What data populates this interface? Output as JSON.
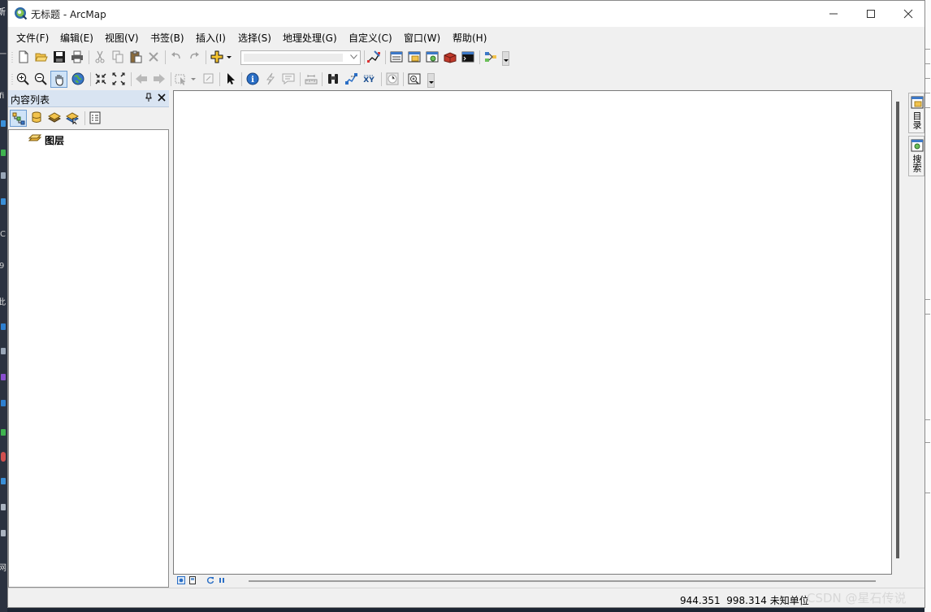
{
  "window": {
    "title": "无标题 - ArcMap"
  },
  "menu": [
    "文件(F)",
    "编辑(E)",
    "视图(V)",
    "书签(B)",
    "插入(I)",
    "选择(S)",
    "地理处理(G)",
    "自定义(C)",
    "窗口(W)",
    "帮助(H)"
  ],
  "toolbar_standard": {
    "buttons": [
      "new-icon",
      "open-icon",
      "save-icon",
      "print-icon",
      "cut-icon",
      "copy-icon",
      "paste-icon",
      "delete-icon",
      "undo-icon",
      "redo-icon",
      "add-data-icon",
      "editor-toolbar-icon",
      "table-of-contents-icon",
      "catalog-window-icon",
      "search-window-icon",
      "arctoolbox-icon",
      "python-icon",
      "model-builder-icon"
    ],
    "scale_value": ""
  },
  "toolbar_tools": {
    "buttons": [
      "zoom-in-icon",
      "zoom-out-icon",
      "pan-icon",
      "full-extent-icon",
      "fixed-zoom-in-icon",
      "fixed-zoom-out-icon",
      "back-icon",
      "forward-icon",
      "select-features-icon",
      "clear-selection-icon",
      "select-elements-icon",
      "identify-icon",
      "hyperlink-icon",
      "html-popup-icon",
      "measure-icon",
      "find-icon",
      "find-route-icon",
      "go-to-xy-icon",
      "time-slider-icon",
      "create-viewer-icon"
    ]
  },
  "toc": {
    "title": "内容列表",
    "tools": [
      "list-by-drawing-order-icon",
      "list-by-source-icon",
      "list-by-visibility-icon",
      "list-by-selection-icon",
      "options-icon"
    ],
    "tree": {
      "root_label": "图层"
    }
  },
  "dock": {
    "catalog_label": "目录",
    "search_label": "搜索"
  },
  "status": {
    "x": "944.351",
    "y": "998.314",
    "units": "未知单位"
  },
  "watermark": "CSDN @星石传说",
  "desktop": {
    "left_glyphs": [
      "新",
      "一",
      "fi",
      "C",
      "9",
      "此",
      "网"
    ]
  },
  "colors": {
    "toc_header": "#d9e4f2",
    "window_bg": "#f0f0f0",
    "map_bg": "#ffffff"
  }
}
